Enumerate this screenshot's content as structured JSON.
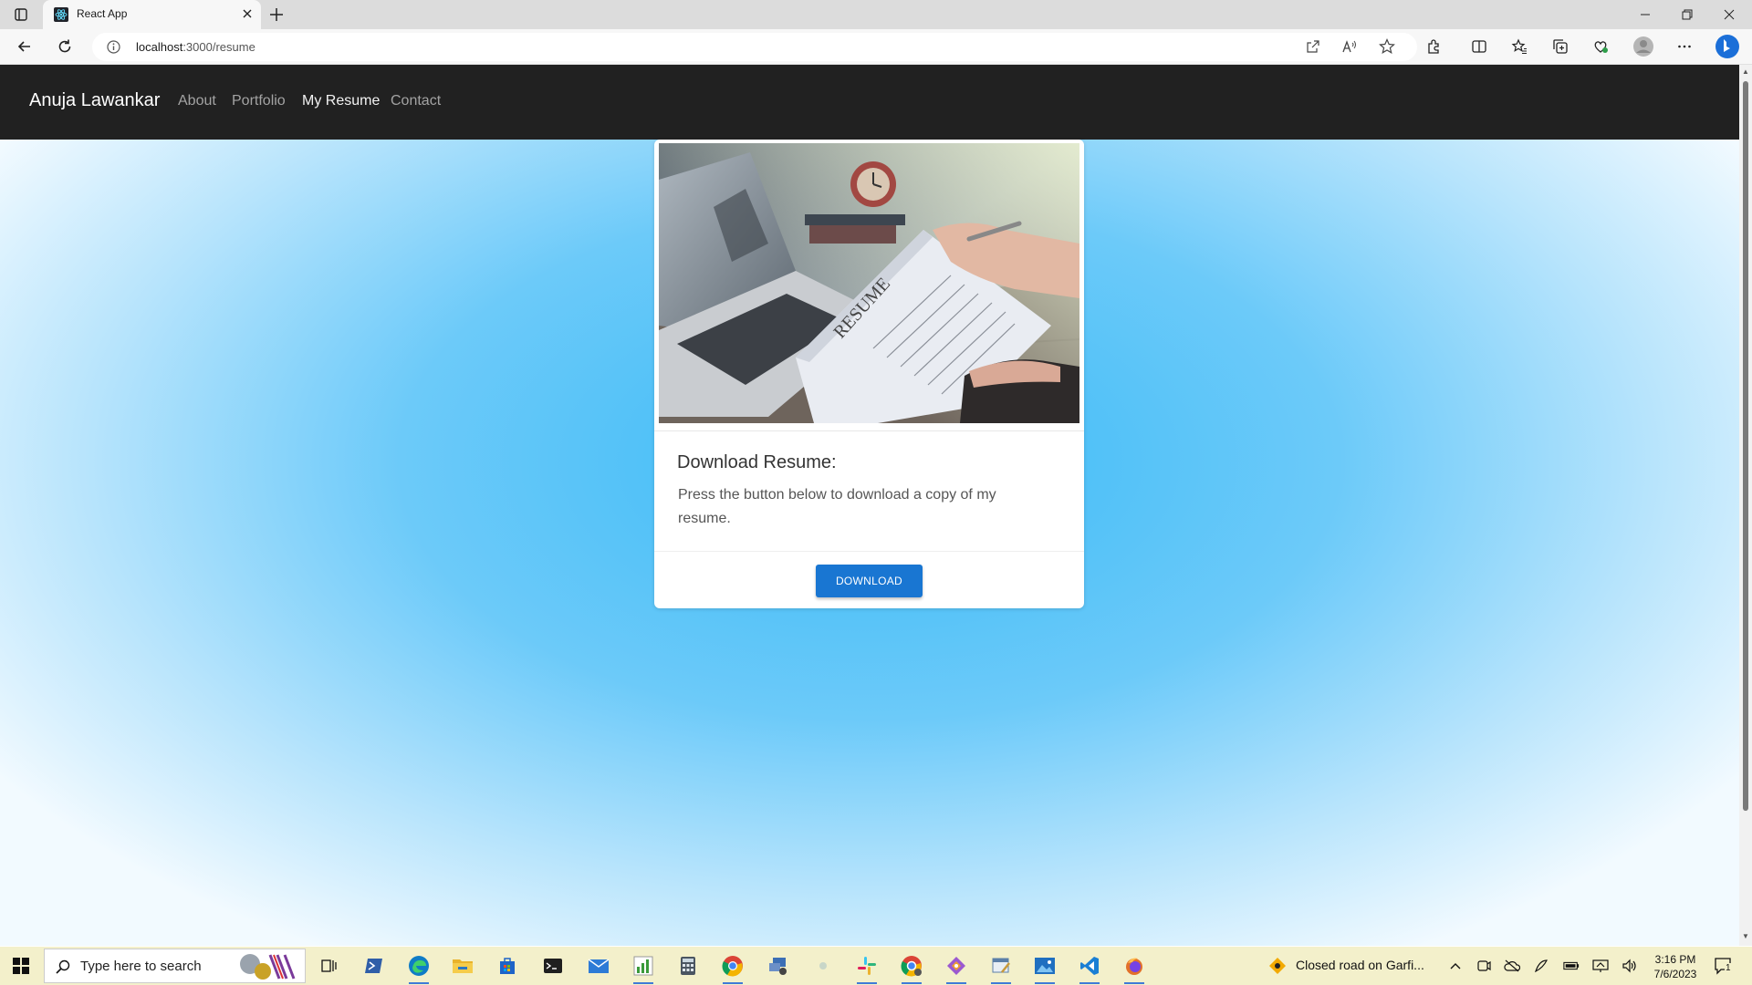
{
  "browser": {
    "tab_title": "React App",
    "url_host": "localhost",
    "url_rest": ":3000/resume"
  },
  "site": {
    "brand": "Anuja Lawankar",
    "nav": [
      "About",
      "Portfolio",
      "My Resume",
      "Contact"
    ],
    "active_nav": "My Resume"
  },
  "card": {
    "image_word": "RESUME",
    "title": "Download Resume:",
    "text": "Press the button below to download a copy of my resume.",
    "button": "DOWNLOAD"
  },
  "taskbar": {
    "search_placeholder": "Type here to search",
    "news": "Closed road on Garfi...",
    "time": "3:16 PM",
    "date": "7/6/2023",
    "notification_count": "1"
  },
  "colors": {
    "navbar": "#212121",
    "accent_button": "#1976d2",
    "page_gradient_center": "#3bbaf7"
  }
}
